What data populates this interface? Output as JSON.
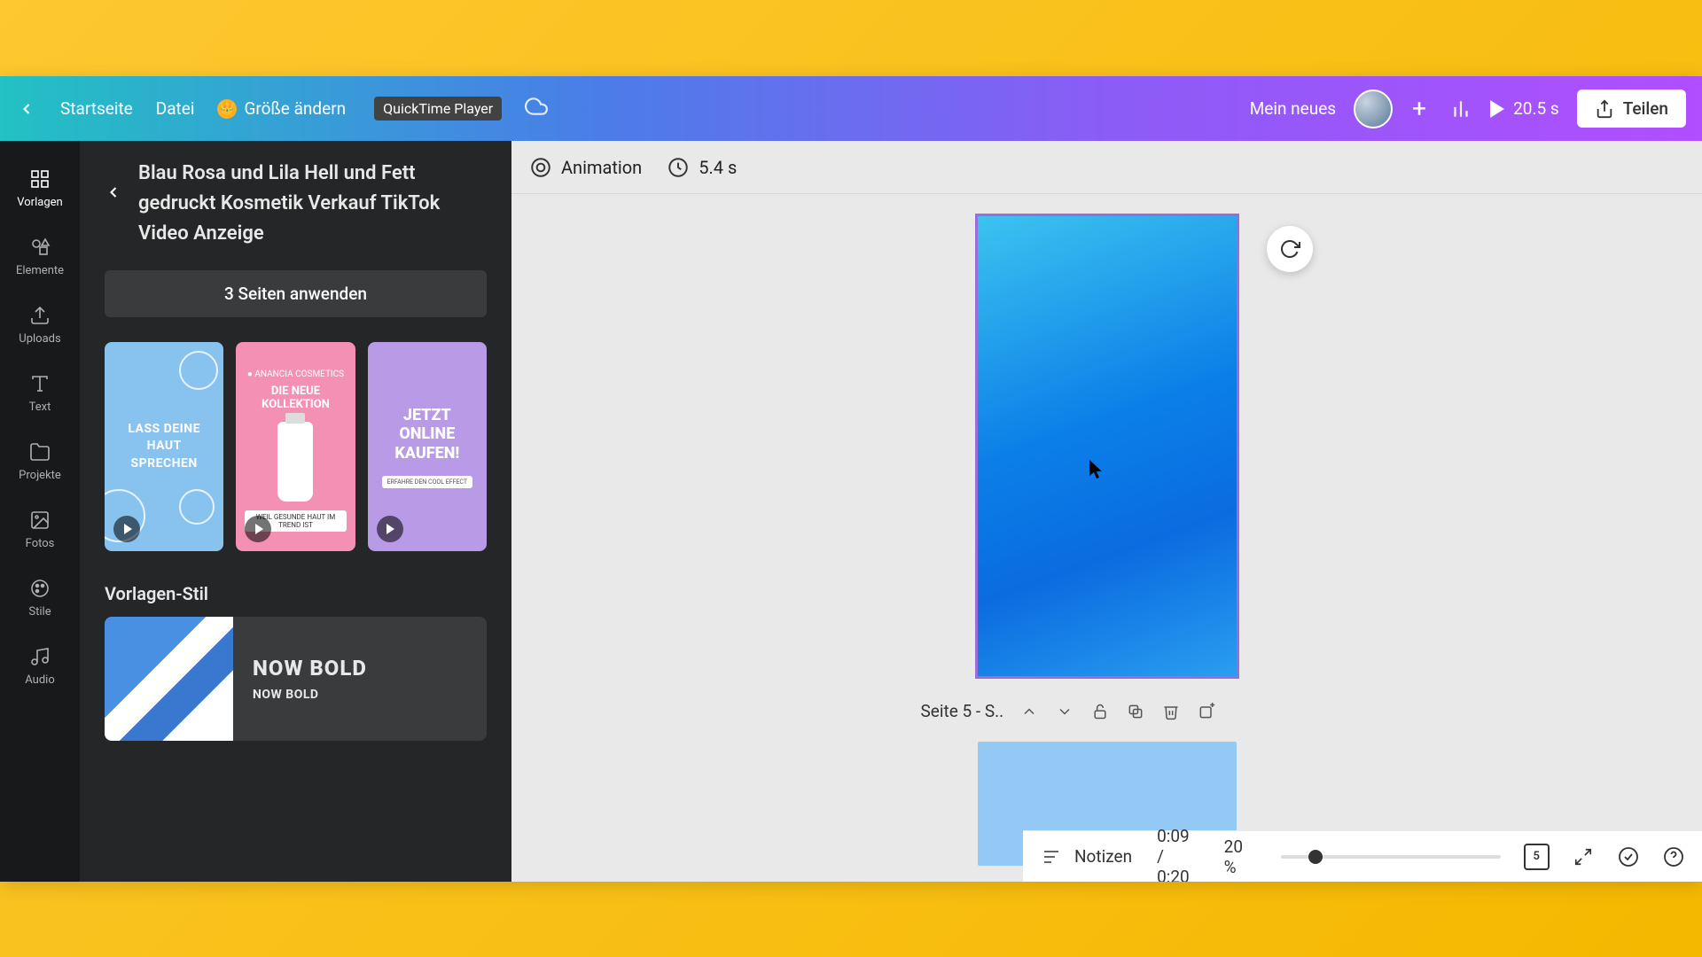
{
  "topbar": {
    "home": "Startseite",
    "file": "Datei",
    "resize": "Größe ändern",
    "quicktime_badge": "QuickTime Player",
    "doc_name": "Mein neues",
    "play_duration": "20.5 s",
    "share": "Teilen"
  },
  "nav": {
    "templates": "Vorlagen",
    "elements": "Elemente",
    "uploads": "Uploads",
    "text": "Text",
    "projects": "Projekte",
    "photos": "Fotos",
    "styles": "Stile",
    "audio": "Audio"
  },
  "panel": {
    "title": "Blau Rosa und Lila Hell und Fett gedruckt Kosmetik Verkauf TikTok Video Anzeige",
    "apply_all": "3 Seiten anwenden",
    "thumb1_text": "LASS DEINE HAUT SPRECHEN",
    "thumb2_top": "● ANANCIA COSMETICS",
    "thumb2_title": "DIE NEUE KOLLEKTION",
    "thumb2_bar": "WEIL GESUNDE HAUT IM TREND IST",
    "thumb3_text": "JETZT ONLINE KAUFEN!",
    "thumb3_bar": "ERFAHRE DEN COOL EFFECT",
    "style_section": "Vorlagen-Stil",
    "style_big": "NOW BOLD",
    "style_small": "NOW BOLD"
  },
  "canvas": {
    "animation": "Animation",
    "duration": "5.4 s",
    "page_label": "Seite 5 - S.."
  },
  "bottombar": {
    "notes": "Notizen",
    "time": "0:09 / 0:20",
    "zoom": "20 %",
    "page_count": "5"
  }
}
